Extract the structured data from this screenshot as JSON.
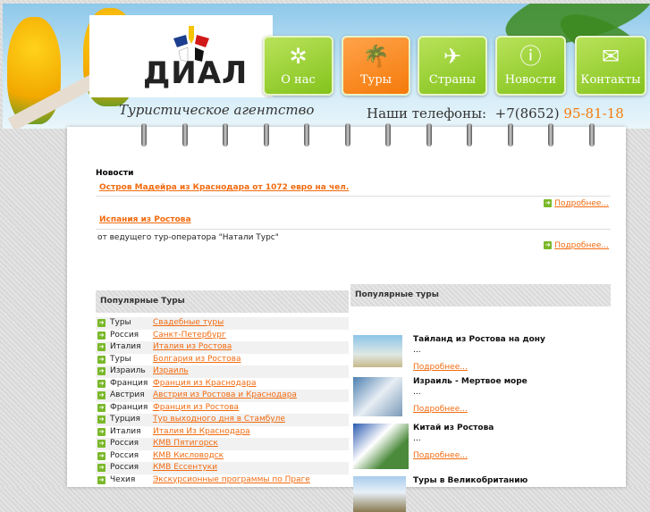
{
  "logo": {
    "name": "ДИАЛ"
  },
  "nav": [
    {
      "label": "О нас",
      "icon": "flower-icon"
    },
    {
      "label": "Туры",
      "icon": "palm-icon",
      "active": true
    },
    {
      "label": "Страны",
      "icon": "plane-icon"
    },
    {
      "label": "Новости",
      "icon": "info-icon"
    },
    {
      "label": "Контакты",
      "icon": "mail-icon"
    }
  ],
  "tagline": "Туристическое агентство",
  "phones": {
    "label": "Наши телефоны:",
    "code": "+7(8652)",
    "number": "95-81-18"
  },
  "news": {
    "title": "Новости",
    "items": [
      {
        "title": "Остров Мадейра из Краснодара от 1072 евро на чел.",
        "text": "",
        "more": "Подробнее..."
      },
      {
        "title": "Испания из Ростова",
        "text": "от ведущего тур-оператора \"Натали Турс\"",
        "more": "Подробнее..."
      }
    ]
  },
  "popular_left": {
    "title": "Популярные Туры",
    "rows": [
      {
        "country": "Туры",
        "tour": "Свадебные туры"
      },
      {
        "country": "Россия",
        "tour": "Санкт-Петербург"
      },
      {
        "country": "Италия",
        "tour": "Италия из Ростова"
      },
      {
        "country": "Туры",
        "tour": "Болгария из Ростова"
      },
      {
        "country": "Израиль",
        "tour": "Израиль"
      },
      {
        "country": "Франция",
        "tour": "Франция из Краснодара"
      },
      {
        "country": "Австрия",
        "tour": "Австрия из Ростова и Краснодара"
      },
      {
        "country": "Франция",
        "tour": "Франция из Ростова"
      },
      {
        "country": "Турция",
        "tour": "Тур выходного дня в Стамбуле"
      },
      {
        "country": "Италия",
        "tour": "Италия Из Краснодара"
      },
      {
        "country": "Россия",
        "tour": "КМВ Пятигорск"
      },
      {
        "country": "Россия",
        "tour": "КМВ Кисловодск"
      },
      {
        "country": "Россия",
        "tour": "КМВ Ессентуки"
      },
      {
        "country": "Чехия",
        "tour": "Экскурсионные программы по Праге"
      }
    ]
  },
  "popular_right": {
    "title": "Популярные туры",
    "items": [
      {
        "title": "Тайланд из Ростова на дону",
        "text": "...",
        "more": "Подробнее..."
      },
      {
        "title": "Израиль - Мертвое море",
        "text": "...",
        "more": "Подробнее..."
      },
      {
        "title": "Китай из Ростова",
        "text": "...",
        "more": "Подробнее..."
      },
      {
        "title": "Туры в Великобританию",
        "text": "",
        "more": ""
      }
    ]
  }
}
